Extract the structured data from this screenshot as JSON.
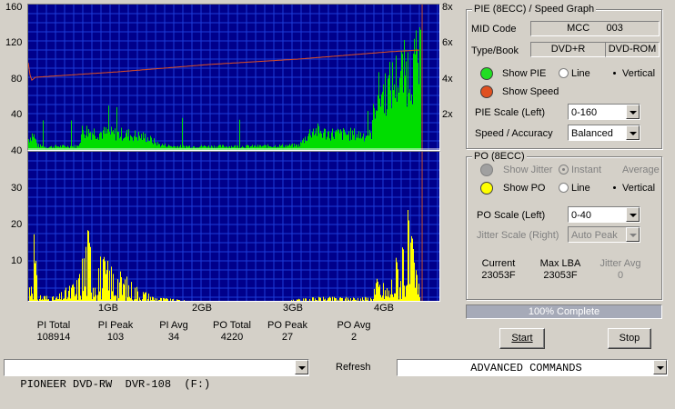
{
  "pie_graph": {
    "y_ticks": [
      "160",
      "120",
      "80",
      "40"
    ],
    "speed_ticks": [
      "8x",
      "6x",
      "4x",
      "2x"
    ]
  },
  "po_graph": {
    "y_ticks": [
      "40",
      "30",
      "20",
      "10"
    ]
  },
  "x_ticks": [
    "1GB",
    "2GB",
    "3GB",
    "4GB"
  ],
  "stats": [
    {
      "label": "PI Total",
      "value": "108914"
    },
    {
      "label": "PI Peak",
      "value": "103"
    },
    {
      "label": "PI Avg",
      "value": "34"
    },
    {
      "label": "PO Total",
      "value": "4220"
    },
    {
      "label": "PO Peak",
      "value": "27"
    },
    {
      "label": "PO Avg",
      "value": "2"
    }
  ],
  "pie_panel": {
    "title": "PIE (8ECC) / Speed Graph",
    "mid_label": "MID Code",
    "mid_value": "MCC      003",
    "type_label": "Type/Book",
    "type_value": "DVD+R",
    "book_value": "DVD-ROM",
    "show_pie": "Show PIE",
    "show_speed": "Show Speed",
    "line": "Line",
    "vertical": "Vertical",
    "scale_label": "PIE Scale (Left)",
    "scale_value": "0-160",
    "speed_label": "Speed / Accuracy",
    "speed_value": "Balanced",
    "pie_color": "#00dd00",
    "speed_color": "#e05020"
  },
  "po_panel": {
    "title": "PO (8ECC)",
    "show_jitter": "Show Jitter",
    "instant": "Instant",
    "average": "Average",
    "show_po": "Show PO",
    "line": "Line",
    "vertical": "Vertical",
    "scale_label": "PO Scale (Left)",
    "scale_value": "0-40",
    "jitter_label": "Jitter Scale (Right)",
    "jitter_value": "Auto Peak",
    "current_label": "Current",
    "current_value": "23053F",
    "maxlba_label": "Max LBA",
    "maxlba_value": "23053F",
    "jitter_avg_label": "Jitter Avg",
    "jitter_avg_value": "0",
    "jitter_color": "#a0a0a0",
    "po_color": "#ffff00"
  },
  "progress": {
    "text": "100% Complete",
    "fraction": 1.0
  },
  "buttons": {
    "start": "Start",
    "stop": "Stop",
    "refresh": "Refresh"
  },
  "drive": {
    "value": "PIONEER DVD-RW  DVR-108  (F:)"
  },
  "commands": {
    "value": "ADVANCED COMMANDS"
  },
  "chart_data": {
    "type": "bar",
    "x_axis": {
      "ticks": [
        "1GB",
        "2GB",
        "3GB",
        "4GB"
      ],
      "range_gb": [
        0,
        4.4
      ]
    },
    "pie": {
      "ylim": [
        0,
        160
      ],
      "speed_ylim": [
        0,
        8
      ],
      "profile_gb": [
        [
          0.0,
          12
        ],
        [
          0.05,
          18
        ],
        [
          0.1,
          5
        ],
        [
          0.2,
          3
        ],
        [
          0.3,
          4
        ],
        [
          0.55,
          4
        ],
        [
          0.6,
          22
        ],
        [
          0.7,
          20
        ],
        [
          0.9,
          18
        ],
        [
          1.1,
          17
        ],
        [
          1.3,
          14
        ],
        [
          1.45,
          6
        ],
        [
          1.6,
          4
        ],
        [
          2.0,
          4
        ],
        [
          2.5,
          4
        ],
        [
          3.0,
          5
        ],
        [
          3.15,
          22
        ],
        [
          3.3,
          18
        ],
        [
          3.6,
          17
        ],
        [
          3.8,
          16
        ],
        [
          3.85,
          58
        ],
        [
          4.0,
          68
        ],
        [
          4.1,
          80
        ],
        [
          4.2,
          86
        ],
        [
          4.3,
          92
        ],
        [
          4.35,
          94
        ]
      ],
      "speed_profile_gb": [
        [
          0.0,
          4.8
        ],
        [
          0.03,
          3.8
        ],
        [
          0.08,
          4.0
        ],
        [
          1.0,
          4.3
        ],
        [
          2.0,
          4.7
        ],
        [
          3.0,
          5.0
        ],
        [
          4.0,
          5.4
        ],
        [
          4.35,
          5.5
        ]
      ]
    },
    "po": {
      "ylim": [
        0,
        40
      ],
      "profile_gb": [
        [
          0.0,
          0
        ],
        [
          0.05,
          26
        ],
        [
          0.1,
          2
        ],
        [
          0.3,
          1
        ],
        [
          0.55,
          6
        ],
        [
          0.65,
          20
        ],
        [
          0.8,
          12
        ],
        [
          1.0,
          8
        ],
        [
          1.2,
          4
        ],
        [
          1.4,
          1
        ],
        [
          1.8,
          0
        ],
        [
          2.8,
          0
        ],
        [
          3.2,
          1
        ],
        [
          3.8,
          1
        ],
        [
          3.85,
          6
        ],
        [
          4.0,
          4
        ],
        [
          4.2,
          24
        ],
        [
          4.35,
          2
        ]
      ]
    }
  }
}
